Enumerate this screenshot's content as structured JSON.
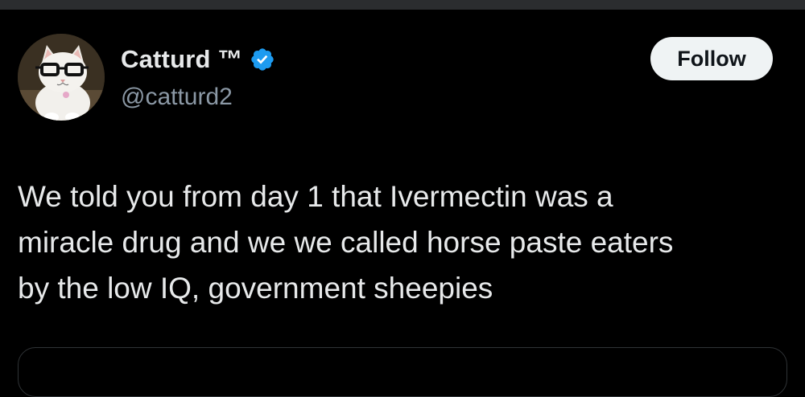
{
  "tweet": {
    "author": {
      "display_name": "Catturd ™",
      "handle": "@catturd2",
      "verified": true,
      "avatar_icon": "cat-with-glasses-avatar"
    },
    "follow_label": "Follow",
    "text_lines": [
      "We told you from day 1 that Ivermectin was a",
      "miracle drug and we we called horse paste eaters",
      "by the low IQ, government sheepies"
    ]
  },
  "colors": {
    "background": "#000000",
    "text_primary": "#e7e9ea",
    "text_secondary": "#8b98a5",
    "verified_badge": "#1d9bf0",
    "button_bg": "#eff3f4",
    "button_text": "#0f1419"
  }
}
